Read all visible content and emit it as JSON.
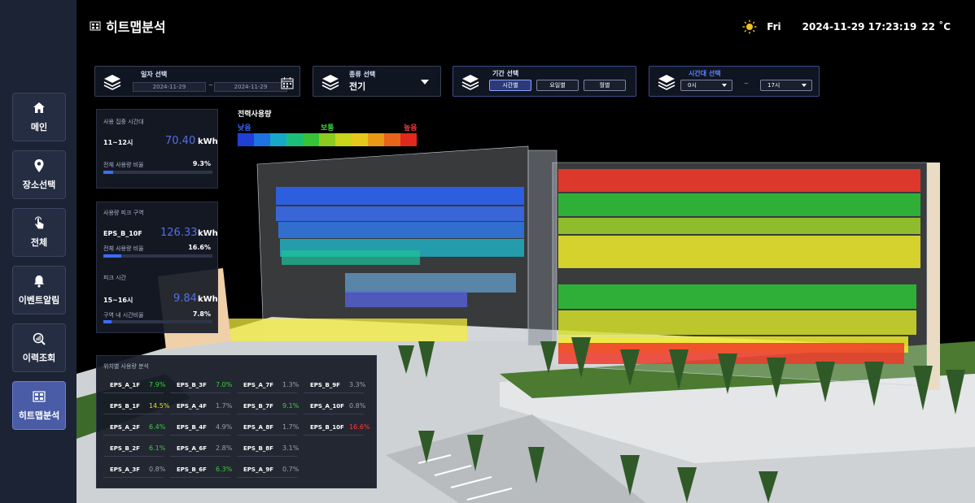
{
  "sidebar": {
    "items": [
      {
        "label": "메인",
        "icon": "home-icon"
      },
      {
        "label": "장소선택",
        "icon": "location-pin-icon"
      },
      {
        "label": "전체",
        "icon": "touch-icon"
      },
      {
        "label": "이벤트알림",
        "icon": "bell-icon"
      },
      {
        "label": "이력조회",
        "icon": "search-chart-icon"
      },
      {
        "label": "히트맵분석",
        "icon": "heatmap-icon",
        "active": true
      }
    ]
  },
  "header": {
    "title": "히트맵분석",
    "weather_icon": "sun-icon",
    "day": "Fri",
    "datetime": "2024-11-29 17:23:19",
    "temperature": "22 ˚C"
  },
  "filters": {
    "date": {
      "title": "일자 선택",
      "start": "2024-11-29",
      "separator": "~",
      "end": "2024-11-29"
    },
    "type": {
      "title": "종류 선택",
      "value": "전기"
    },
    "period": {
      "title": "기간 선택",
      "options": [
        "시간별",
        "요일별",
        "월별"
      ],
      "selected": "시간별"
    },
    "timerange": {
      "title": "시간대 선택",
      "start": "0시",
      "separator": "~",
      "end": "17시"
    }
  },
  "legend": {
    "title": "전력사용량",
    "low": "낮음",
    "mid": "보통",
    "high": "높음",
    "colors": [
      "#1f3fd6",
      "#1f73e0",
      "#17a8c8",
      "#1cbf7a",
      "#38c238",
      "#8ccc21",
      "#c8d41a",
      "#e6c81a",
      "#e89a16",
      "#e8641a",
      "#e0281c"
    ]
  },
  "peak_time_panel": {
    "title": "사용 집중 시간대",
    "time": "11~12시",
    "value": "70.40",
    "unit": "kWh",
    "ratio_label": "전체 사용량 비율",
    "ratio": "9.3%",
    "ratio_fraction": 0.093
  },
  "peak_zone_panel": {
    "title": "사용량 피크 구역",
    "zone": "EPS_B_10F",
    "value": "126.33",
    "unit": "kWh",
    "ratio_label": "전체 사용량 비율",
    "ratio": "16.6%",
    "ratio_fraction": 0.166,
    "peak_title": "피크 시간",
    "peak_time": "15~16시",
    "peak_value": "9.84",
    "peak_unit": "kWh",
    "peak_ratio_label": "구역 내 시간비율",
    "peak_ratio": "7.8%",
    "peak_ratio_fraction": 0.078
  },
  "location_table": {
    "title": "위치별 사용량 분석",
    "rows": [
      [
        {
          "name": "EPS_A_1F",
          "value": "7.9%",
          "color": "#3ad13a"
        },
        {
          "name": "EPS_B_3F",
          "value": "7.0%",
          "color": "#3ad13a"
        },
        {
          "name": "EPS_A_7F",
          "value": "1.3%",
          "color": "#9aa0b0"
        },
        {
          "name": "EPS_B_9F",
          "value": "3.3%",
          "color": "#9aa0b0"
        }
      ],
      [
        {
          "name": "EPS_B_1F",
          "value": "14.5%",
          "color": "#f0dc1e"
        },
        {
          "name": "EPS_A_4F",
          "value": "1.7%",
          "color": "#9aa0b0"
        },
        {
          "name": "EPS_B_7F",
          "value": "9.1%",
          "color": "#3ad13a"
        },
        {
          "name": "EPS_A_10F",
          "value": "0.8%",
          "color": "#9aa0b0"
        }
      ],
      [
        {
          "name": "EPS_A_2F",
          "value": "6.4%",
          "color": "#3ad13a"
        },
        {
          "name": "EPS_B_4F",
          "value": "4.9%",
          "color": "#9aa0b0"
        },
        {
          "name": "EPS_A_8F",
          "value": "1.7%",
          "color": "#9aa0b0"
        },
        {
          "name": "EPS_B_10F",
          "value": "16.6%",
          "color": "#ff3a3a"
        }
      ],
      [
        {
          "name": "EPS_B_2F",
          "value": "6.1%",
          "color": "#3ad13a"
        },
        {
          "name": "EPS_A_6F",
          "value": "2.8%",
          "color": "#9aa0b0"
        },
        {
          "name": "EPS_B_8F",
          "value": "3.1%",
          "color": "#9aa0b0"
        }
      ],
      [
        {
          "name": "EPS_A_3F",
          "value": "0.8%",
          "color": "#9aa0b0"
        },
        {
          "name": "EPS_B_6F",
          "value": "6.3%",
          "color": "#3ad13a"
        },
        {
          "name": "EPS_A_9F",
          "value": "0.7%",
          "color": "#9aa0b0"
        }
      ]
    ]
  }
}
